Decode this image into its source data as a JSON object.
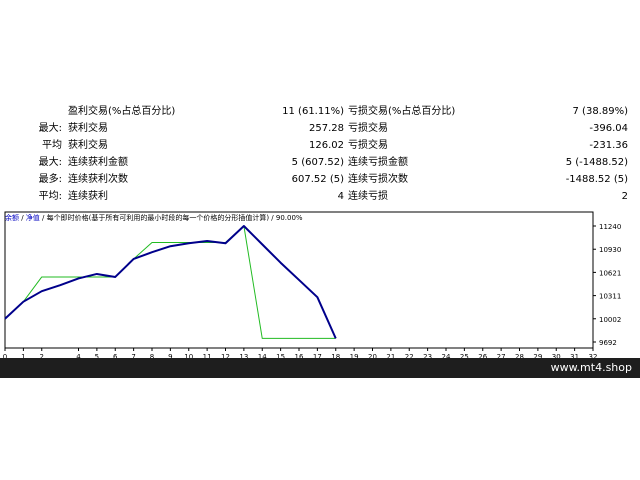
{
  "stats": {
    "rows": [
      {
        "prefix": "",
        "left_label": "盈利交易(%占总百分比)",
        "left_value": "11 (61.11%)",
        "right_label": "亏损交易(%占总百分比)",
        "right_value": "7 (38.89%)"
      },
      {
        "prefix": "最大:",
        "left_label": "获利交易",
        "left_value": "257.28",
        "right_label": "亏损交易",
        "right_value": "-396.04"
      },
      {
        "prefix": "平均",
        "left_label": "获利交易",
        "left_value": "126.02",
        "right_label": "亏损交易",
        "right_value": "-231.36"
      },
      {
        "prefix": "最大:",
        "left_label": "连续获利金额",
        "left_value": "5 (607.52)",
        "right_label": "连续亏损金额",
        "right_value": "5 (-1488.52)"
      },
      {
        "prefix": "最多:",
        "left_label": "连续获利次数",
        "left_value": "607.52 (5)",
        "right_label": "连续亏损次数",
        "right_value": "-1488.52 (5)"
      },
      {
        "prefix": "平均:",
        "left_label": "连续获利",
        "left_value": "4",
        "right_label": "连续亏损",
        "right_value": "2"
      }
    ]
  },
  "chart_header": {
    "link1": "余额",
    "sep1": " / ",
    "link2": "净值",
    "sep2": " / ",
    "text": "每个即时价格(基于所有可利用的最小时段的每一个价格的分形插值计算) / 90.00%"
  },
  "chart_data": {
    "type": "line",
    "title": "",
    "xlabel": "",
    "ylabel": "",
    "xlim": [
      0,
      32
    ],
    "ylim": [
      9692,
      11240
    ],
    "x_ticks": [
      0,
      1,
      2,
      4,
      5,
      6,
      7,
      8,
      9,
      10,
      11,
      12,
      13,
      14,
      15,
      16,
      17,
      18,
      19,
      20,
      21,
      22,
      23,
      24,
      25,
      26,
      27,
      28,
      29,
      30,
      31,
      32
    ],
    "y_ticks": [
      11240,
      10930,
      10621,
      10311,
      10002,
      9692
    ],
    "grid": false,
    "series": [
      {
        "color": "#00008b",
        "x": [
          0,
          1,
          2,
          3,
          4,
          5,
          6,
          7,
          8,
          9,
          10,
          11,
          12,
          13,
          14,
          15,
          16,
          17,
          18
        ],
        "y": [
          10002,
          10230,
          10370,
          10450,
          10540,
          10600,
          10560,
          10800,
          10890,
          10970,
          11010,
          11040,
          11010,
          11240,
          10995,
          10750,
          10520,
          10290,
          9740
        ]
      },
      {
        "color": "#22bb22",
        "x": [
          0,
          1,
          2,
          3,
          4,
          5,
          6,
          7,
          8,
          9,
          10,
          11,
          12,
          13,
          14,
          15,
          16,
          17,
          18
        ],
        "y": [
          10002,
          10230,
          10560,
          10560,
          10560,
          10560,
          10560,
          10800,
          11020,
          11020,
          11020,
          11020,
          11020,
          11240,
          9740,
          9740,
          9740,
          9740,
          9740
        ]
      }
    ]
  },
  "footer": {
    "text": "www.mt4.shop"
  }
}
